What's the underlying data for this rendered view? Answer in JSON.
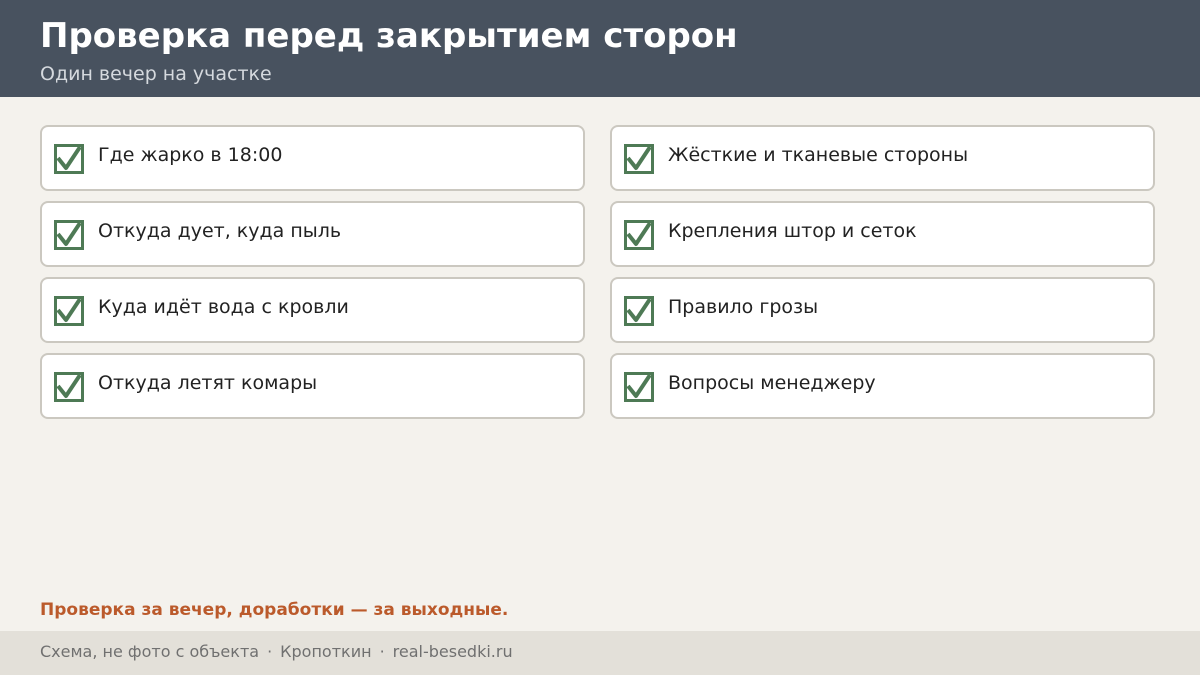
{
  "header": {
    "title": "Проверка перед закрытием сторон",
    "subtitle": "Один вечер на участке"
  },
  "checklist": {
    "left": [
      {
        "label": "Где жарко в 18:00",
        "checked": true
      },
      {
        "label": "Откуда дует, куда пыль",
        "checked": true
      },
      {
        "label": "Куда идёт вода с кровли",
        "checked": true
      },
      {
        "label": "Откуда летят комары",
        "checked": true
      }
    ],
    "right": [
      {
        "label": "Жёсткие и тканевые стороны",
        "checked": true
      },
      {
        "label": "Крепления штор и сеток",
        "checked": true
      },
      {
        "label": "Правило грозы",
        "checked": true
      },
      {
        "label": "Вопросы менеджеру",
        "checked": true
      }
    ],
    "check_color": "#4e7a55"
  },
  "footer": {
    "note": "Проверка за вечер, доработки — за выходные.",
    "note_color": "#bb5a2b",
    "parts": [
      "Схема, не фото с объекта",
      "Кропоткин",
      "real-besedki.ru"
    ],
    "separator": "·"
  },
  "colors": {
    "header_bg": "#48525f",
    "page_bg": "#f4f2ed",
    "footer_bg": "#e3e0d9"
  }
}
